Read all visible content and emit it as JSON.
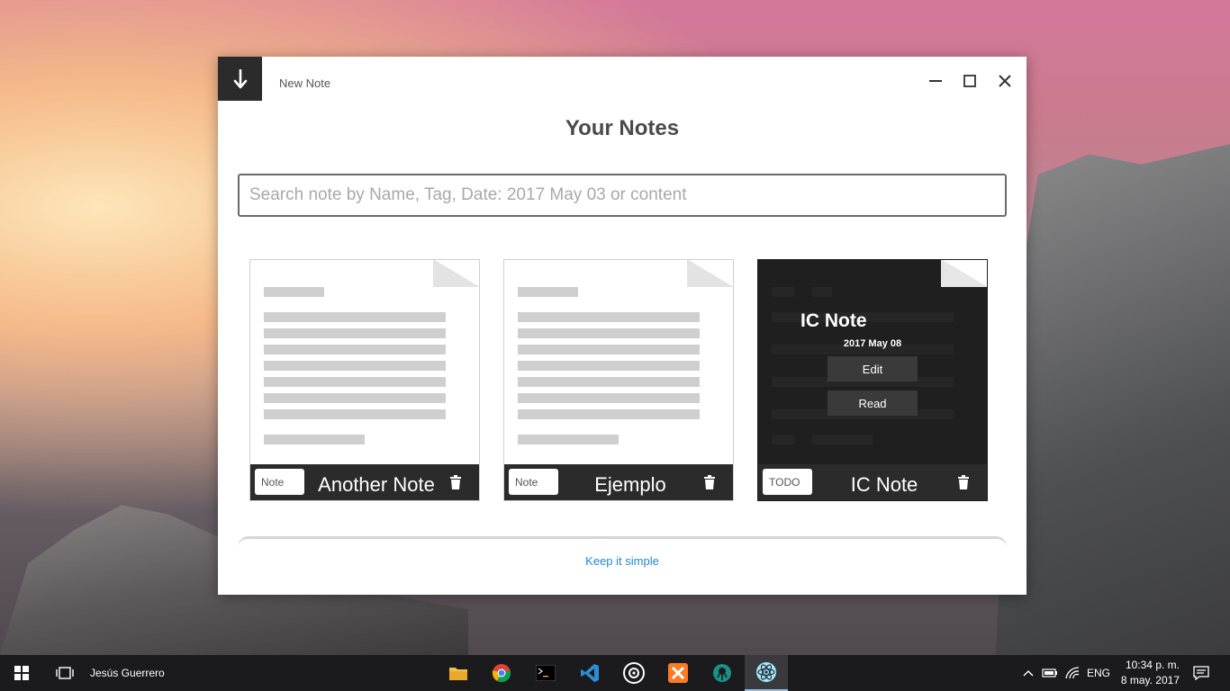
{
  "window": {
    "new_note_label": "New Note",
    "title": "Your Notes",
    "search": {
      "placeholder": "Search note by Name, Tag, Date: 2017 May 03 or content",
      "value": ""
    },
    "footer_link": "Keep it simple"
  },
  "notes": [
    {
      "name": "Another Note",
      "tag": "Note",
      "theme": "light"
    },
    {
      "name": "Ejemplo",
      "tag": "Note",
      "theme": "light"
    },
    {
      "name": "IC Note",
      "tag": "TODO",
      "theme": "dark",
      "overlay": {
        "title": "IC Note",
        "date": "2017 May 08",
        "edit_label": "Edit",
        "read_label": "Read"
      }
    }
  ],
  "taskbar": {
    "user": "Jesús Guerrero",
    "apps": [
      "file-explorer-icon",
      "chrome-icon",
      "terminal-icon",
      "vscode-icon",
      "obs-icon",
      "xampp-icon",
      "gitkraken-icon",
      "electron-icon"
    ],
    "language": "ENG",
    "time": "10:34 p. m.",
    "date": "8 may. 2017"
  },
  "colors": {
    "accent_link": "#1e88d6",
    "dark_card": "#1f1f1f",
    "footer_bar": "#2b2b2b"
  }
}
